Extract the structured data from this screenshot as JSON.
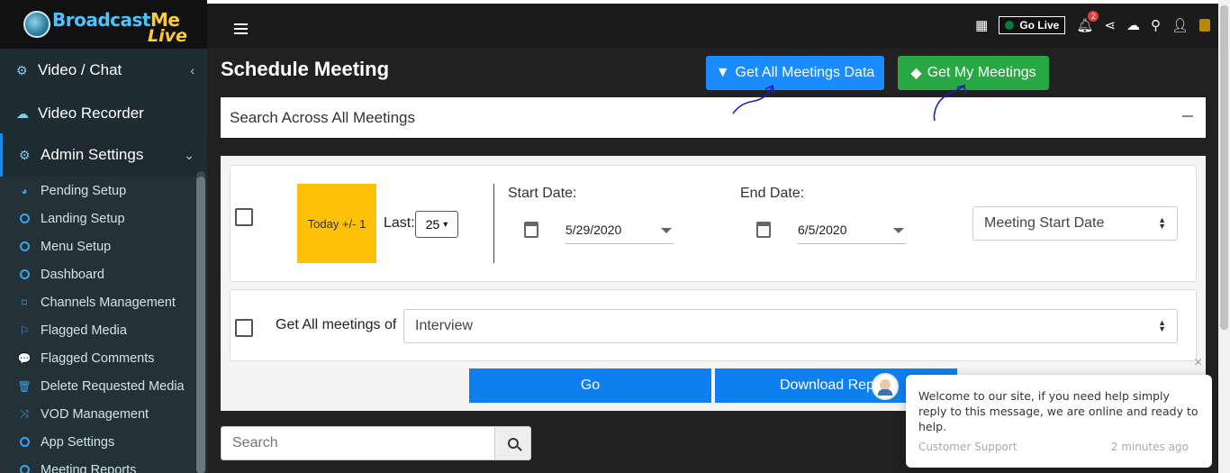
{
  "logo": {
    "part1": "Broadcast",
    "part2": "Me",
    "line2": "Live"
  },
  "sidebar": {
    "top_items": [
      {
        "label": "Video / Chat"
      },
      {
        "label": "Video Recorder"
      },
      {
        "label": "Admin Settings"
      }
    ],
    "sub_items": [
      {
        "label": "Pending Setup",
        "icon": "pie-chart-icon"
      },
      {
        "label": "Landing Setup",
        "icon": "circle-icon"
      },
      {
        "label": "Menu Setup",
        "icon": "circle-icon"
      },
      {
        "label": "Dashboard",
        "icon": "circle-icon"
      },
      {
        "label": "Channels Management",
        "icon": "bookmark-icon"
      },
      {
        "label": "Flagged Media",
        "icon": "flag-icon"
      },
      {
        "label": "Flagged Comments",
        "icon": "comments-icon"
      },
      {
        "label": "Delete Requested Media",
        "icon": "trash-icon"
      },
      {
        "label": "VOD Management",
        "icon": "shuffle-icon"
      },
      {
        "label": "App Settings",
        "icon": "circle-icon"
      },
      {
        "label": "Meeting Reports",
        "icon": "circle-icon"
      }
    ]
  },
  "topbar": {
    "go_live": "Go Live",
    "notification_count": "2"
  },
  "main": {
    "title": "Schedule Meeting",
    "btn_all_meetings": "Get All Meetings Data",
    "btn_my_meetings": "Get My Meetings",
    "search_across": "Search Across All Meetings",
    "today_btn": "Today +/- 1",
    "last_label": "Last:",
    "last_value": "25",
    "start_date_label": "Start Date:",
    "start_date_value": "5/29/2020",
    "end_date_label": "End Date:",
    "end_date_value": "6/5/2020",
    "sort_select": "Meeting Start Date",
    "get_all_label": "Get All meetings of",
    "type_select": "Interview",
    "go_btn": "Go",
    "download_btn": "Download Rep",
    "search_placeholder": "Search"
  },
  "chat": {
    "message": "Welcome to our site, if you need help simply reply to this message, we are online and ready to help.",
    "sender": "Customer Support",
    "time": "2 minutes ago"
  },
  "colors": {
    "primary_blue": "#1a8cff",
    "success_green": "#28a745",
    "warning_yellow": "#ffc107",
    "sidebar_bg": "#243238"
  }
}
